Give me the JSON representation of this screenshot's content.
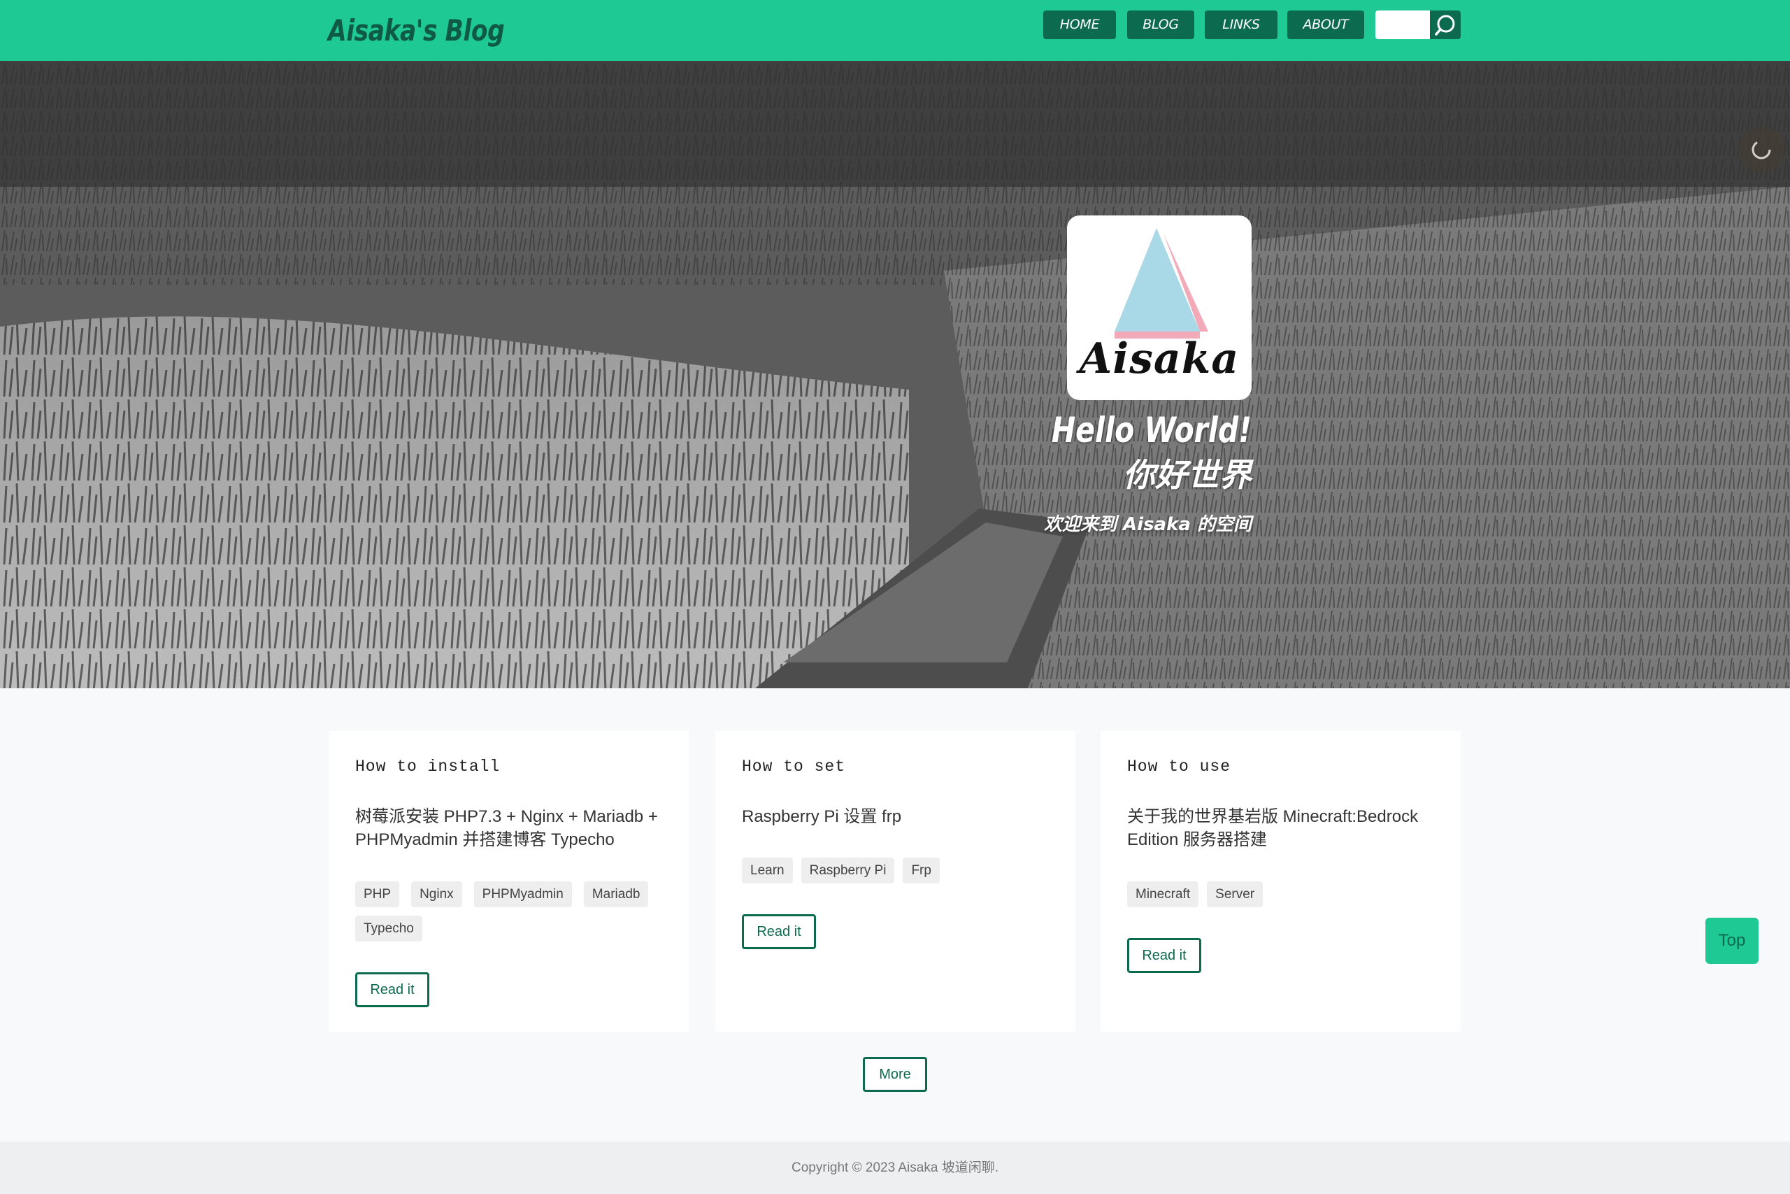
{
  "navbar": {
    "brand": "Aisaka's Blog",
    "items": [
      {
        "label": "HOME"
      },
      {
        "label": "BLOG"
      },
      {
        "label": "LINKS"
      },
      {
        "label": "ABOUT"
      }
    ],
    "search": {
      "placeholder": "",
      "icon": "search-icon"
    }
  },
  "hero": {
    "logo_text": "Aisaka",
    "title_en": "Hello World!",
    "title_cn": "你好世界",
    "subtitle": "欢迎来到 Aisaka 的空间",
    "music_icon": "spinner-icon"
  },
  "posts": [
    {
      "kicker": "How to install",
      "title": "树莓派安装 PHP7.3 + Nginx + Mariadb + PHPMyadmin 并搭建博客 Typecho",
      "tags": [
        "PHP",
        "Nginx",
        "PHPMyadmin",
        "Mariadb",
        "Typecho"
      ],
      "button": "Read it"
    },
    {
      "kicker": "How to set",
      "title": "Raspberry Pi 设置 frp",
      "tags": [
        "Learn",
        "Raspberry Pi",
        "Frp"
      ],
      "button": "Read it"
    },
    {
      "kicker": "How to use",
      "title": "关于我的世界基岩版 Minecraft:Bedrock Edition 服务器搭建",
      "tags": [
        "Minecraft",
        "Server"
      ],
      "button": "Read it"
    }
  ],
  "more_button": "More",
  "top_button": "Top",
  "footer": {
    "copyright": "Copyright © 2023 Aisaka 坡道闲聊."
  },
  "colors": {
    "accent": "#1fc994",
    "dark_accent": "#0c6b4f",
    "background": "#f8f9fa"
  }
}
